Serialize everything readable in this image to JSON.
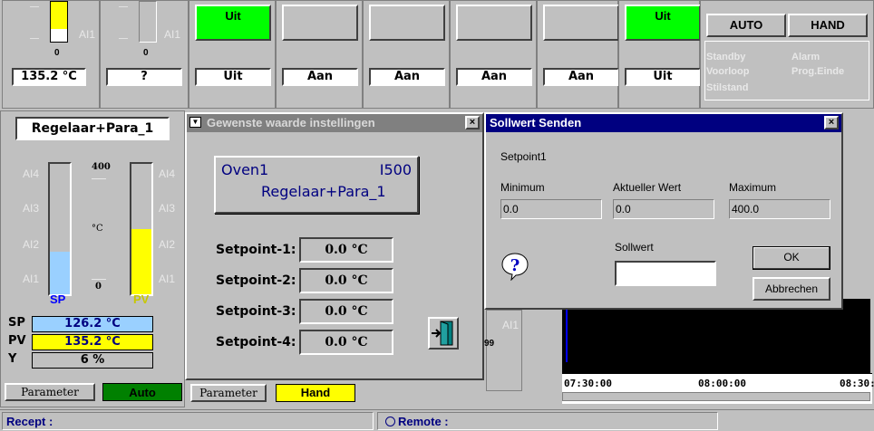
{
  "top_row": {
    "channel1": {
      "ai_label": "AI1",
      "bar_zero": "0",
      "value": "135.2 °C"
    },
    "channel2": {
      "ai_label": "AI1",
      "bar_zero": "0",
      "value": "?"
    },
    "outputs": [
      {
        "top_label": "Uit",
        "top_color": "#00ff00",
        "bottom_label": "Uit"
      },
      {
        "top_label": "",
        "top_color": "#c0c0c0",
        "bottom_label": "Aan"
      },
      {
        "top_label": "",
        "top_color": "#c0c0c0",
        "bottom_label": "Aan"
      },
      {
        "top_label": "",
        "top_color": "#c0c0c0",
        "bottom_label": "Aan"
      },
      {
        "top_label": "",
        "top_color": "#c0c0c0",
        "bottom_label": "Aan"
      },
      {
        "top_label": "Uit",
        "top_color": "#00ff00",
        "bottom_label": "Uit"
      }
    ],
    "mode": {
      "auto_label": "AUTO",
      "hand_label": "HAND",
      "status_left": [
        "Standby",
        "Voorloop",
        "Stilstand"
      ],
      "status_right": [
        "Alarm",
        "Prog.Einde"
      ]
    }
  },
  "controller": {
    "title": "Regelaar+Para_1",
    "scale_top": "400",
    "scale_unit": "°C",
    "scale_zero": "0",
    "left_ai": [
      "AI4",
      "AI3",
      "AI2",
      "AI1"
    ],
    "right_ai": [
      "AI4",
      "AI3",
      "AI2",
      "AI1"
    ],
    "sp_bar_fraction": 0.33,
    "pv_bar_fraction": 0.5,
    "sp_tag": "SP",
    "pv_tag": "PV",
    "rows": [
      {
        "label": "SP",
        "value": "126.2 °C",
        "color": "#9ad0ff"
      },
      {
        "label": "PV",
        "value": "135.2 °C",
        "color": "#ffff00"
      },
      {
        "label": "Y",
        "value": "6 %",
        "color": "#c0c0c0"
      }
    ],
    "parameter_label": "Parameter",
    "auto_label": "Auto"
  },
  "setpoint_dialog": {
    "title": "Gewenste waarde instellingen",
    "oven": "Oven1",
    "code": "I500",
    "controller": "Regelaar+Para_1",
    "setpoints": [
      {
        "label": "Setpoint-1:",
        "value": "0.0 °C"
      },
      {
        "label": "Setpoint-2:",
        "value": "0.0 °C"
      },
      {
        "label": "Setpoint-3:",
        "value": "0.0 °C"
      },
      {
        "label": "Setpoint-4:",
        "value": "0.0 °C"
      }
    ],
    "parameter_label": "Parameter",
    "hand_label": "Hand",
    "exit_icon": "exit-door-icon"
  },
  "sollwert_dialog": {
    "title": "Sollwert Senden",
    "setpoint_name": "Setpoint1",
    "min_label": "Minimum",
    "cur_label": "Aktueller Wert",
    "max_label": "Maximum",
    "min_value": "0.0",
    "cur_value": "0.0",
    "max_value": "400.0",
    "sollwert_label": "Sollwert",
    "sollwert_value": "",
    "ok_label": "OK",
    "cancel_label": "Abbrechen",
    "icon": "question-icon"
  },
  "trend": {
    "times": [
      "07:30:00",
      "08:00:00",
      "08:30:"
    ],
    "ai_label": "AI1",
    "partial_value": "99"
  },
  "status_bar": {
    "recept_label": "Recept :",
    "remote_label": "Remote :"
  },
  "colors": {
    "green": "#00ff00",
    "yellow": "#ffff00",
    "sp_blue": "#9ad0ff",
    "dark_green": "#008000",
    "titlebar_blue": "#000080",
    "titlebar_gray": "#808080",
    "navy_text": "#000080"
  }
}
